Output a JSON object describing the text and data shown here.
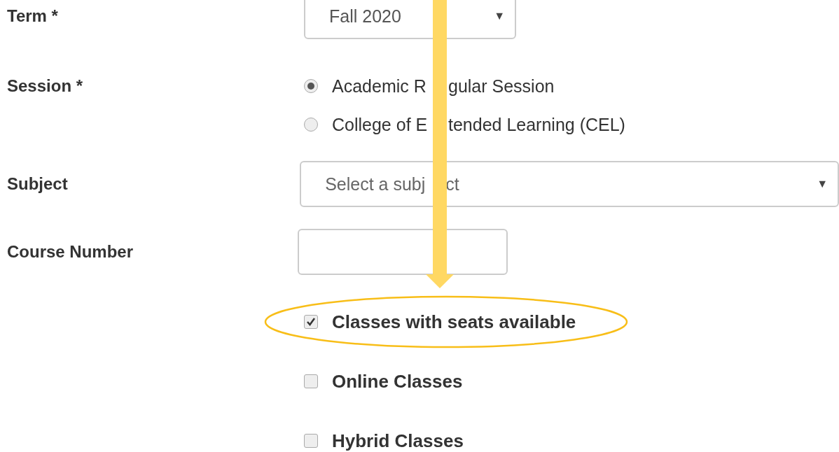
{
  "fields": [
    {
      "kind": "select",
      "label": "Term *",
      "value": [
        "Fall 2020"
      ],
      "caret": "▼",
      "wide": false
    },
    {
      "kind": "radios",
      "label": "Session *",
      "options": [
        {
          "label": [
            "Academic R",
            "gular Session"
          ],
          "selected": true
        },
        {
          "label": [
            "College of E",
            "tended Learning (CEL)"
          ],
          "selected": false
        }
      ]
    },
    {
      "kind": "select",
      "label": "Subject",
      "placeholder": [
        "Select a subj",
        "ct"
      ],
      "caret": "▼",
      "wide": true
    },
    {
      "kind": "text",
      "label": "Course Number"
    }
  ],
  "filters": [
    {
      "label": "Classes with seats available",
      "checked": true,
      "highlighted": true
    },
    {
      "label": "Online Classes",
      "checked": false,
      "highlighted": false
    },
    {
      "label": "Hybrid Classes",
      "checked": false,
      "highlighted": false
    }
  ]
}
